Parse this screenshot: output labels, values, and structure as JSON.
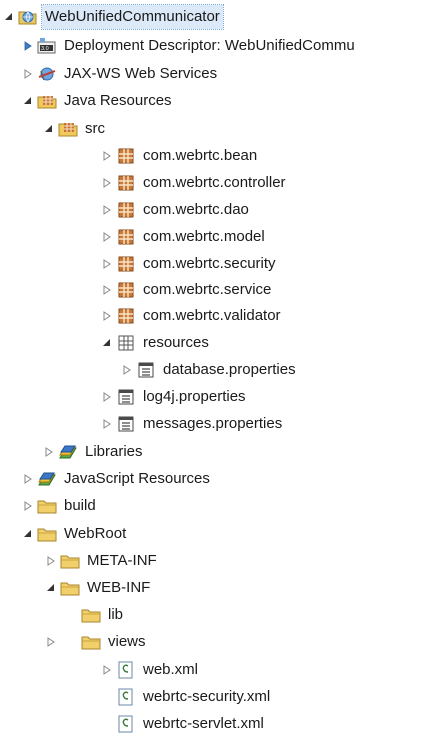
{
  "tree": {
    "items": [
      {
        "label": "WebUnifiedCommunicator",
        "toggle": "open",
        "icon": "web-project-icon"
      },
      {
        "label": "Deployment Descriptor: WebUnifiedCommu",
        "toggle": "closed-blue",
        "icon": "deployment-descriptor-icon"
      },
      {
        "label": "JAX-WS Web Services",
        "toggle": "closed",
        "icon": "web-services-icon"
      },
      {
        "label": "Java Resources",
        "toggle": "open",
        "icon": "java-resources-icon"
      },
      {
        "label": "src",
        "toggle": "open",
        "icon": "source-folder-icon"
      },
      {
        "label": "com.webrtc.bean",
        "toggle": "closed",
        "icon": "package-icon"
      },
      {
        "label": "com.webrtc.controller",
        "toggle": "closed",
        "icon": "package-icon"
      },
      {
        "label": "com.webrtc.dao",
        "toggle": "closed",
        "icon": "package-icon"
      },
      {
        "label": "com.webrtc.model",
        "toggle": "closed",
        "icon": "package-icon"
      },
      {
        "label": "com.webrtc.security",
        "toggle": "closed",
        "icon": "package-icon"
      },
      {
        "label": "com.webrtc.service",
        "toggle": "closed",
        "icon": "package-icon"
      },
      {
        "label": "com.webrtc.validator",
        "toggle": "closed",
        "icon": "package-icon"
      },
      {
        "label": "resources",
        "toggle": "open",
        "icon": "resource-package-icon"
      },
      {
        "label": "database.properties",
        "toggle": "closed",
        "icon": "properties-file-icon"
      },
      {
        "label": "log4j.properties",
        "toggle": "closed",
        "icon": "properties-file-icon"
      },
      {
        "label": "messages.properties",
        "toggle": "closed",
        "icon": "properties-file-icon"
      },
      {
        "label": "Libraries",
        "toggle": "closed",
        "icon": "libraries-icon"
      },
      {
        "label": "JavaScript Resources",
        "toggle": "closed",
        "icon": "libraries-icon"
      },
      {
        "label": "build",
        "toggle": "closed",
        "icon": "folder-icon"
      },
      {
        "label": "WebRoot",
        "toggle": "open",
        "icon": "folder-icon"
      },
      {
        "label": "META-INF",
        "toggle": "closed",
        "icon": "folder-icon"
      },
      {
        "label": "WEB-INF",
        "toggle": "open",
        "icon": "folder-icon"
      },
      {
        "label": "lib",
        "toggle": "none",
        "icon": "folder-icon"
      },
      {
        "label": "views",
        "toggle": "closed",
        "icon": "folder-icon"
      },
      {
        "label": "web.xml",
        "toggle": "closed",
        "icon": "xml-file-icon"
      },
      {
        "label": "webrtc-security.xml",
        "toggle": "none",
        "icon": "xml-file-icon"
      },
      {
        "label": "webrtc-servlet.xml",
        "toggle": "none",
        "icon": "xml-file-icon"
      }
    ]
  },
  "colors": {
    "selection": "#dbe9f9",
    "package": "#b5651d",
    "folder": "#e8b84a",
    "file_border": "#6a8aa8"
  }
}
